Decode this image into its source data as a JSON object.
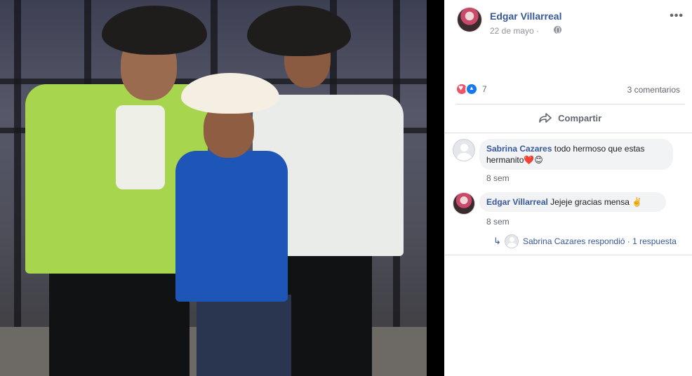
{
  "post": {
    "author": "Edgar Villarreal",
    "date": "22 de mayo",
    "date_separator": "·",
    "privacy_icon": "globe-icon",
    "more_icon": "more-icon"
  },
  "reactions": {
    "types": [
      "love",
      "like"
    ],
    "count": "7",
    "comments_count": "3 comentarios"
  },
  "actions": {
    "share_label": "Compartir"
  },
  "comments": [
    {
      "author": "Sabrina Cazares",
      "text": "todo hermoso que estas hermanito❤️😊",
      "time": "8 sem"
    },
    {
      "author": "Edgar Villarreal",
      "text": "Jejeje gracias mensa ✌️",
      "time": "8 sem"
    }
  ],
  "reply_summary": {
    "text": "Sabrina Cazares respondió · 1 respuesta"
  },
  "colors": {
    "link": "#385898",
    "meta": "#90949c",
    "bubble": "#f2f3f5",
    "love": "#f25268",
    "like": "#1877f2"
  }
}
